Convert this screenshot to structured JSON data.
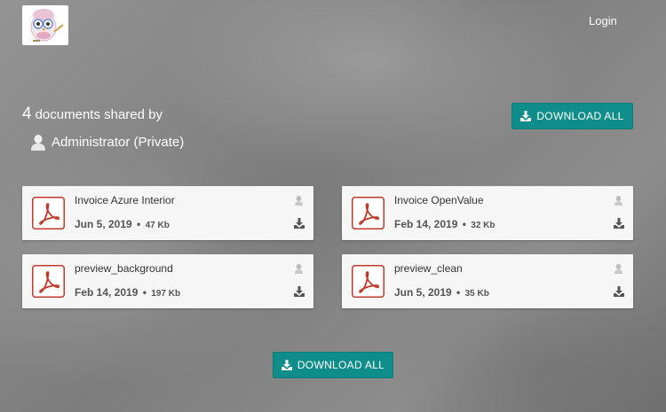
{
  "header": {
    "login_label": "Login"
  },
  "share": {
    "count": "4",
    "heading_text": "documents shared by",
    "owner": "Administrator (Private)"
  },
  "actions": {
    "download_all_label": "DOWNLOAD ALL"
  },
  "documents": [
    {
      "name": "Invoice Azure Interior",
      "date": "Jun 5, 2019",
      "size": "47 Kb"
    },
    {
      "name": "Invoice OpenValue",
      "date": "Feb 14, 2019",
      "size": "32 Kb"
    },
    {
      "name": "preview_background",
      "date": "Feb 14, 2019",
      "size": "197 Kb"
    },
    {
      "name": "preview_clean",
      "date": "Jun 5, 2019",
      "size": "35 Kb"
    }
  ],
  "colors": {
    "accent": "#0f8d8a",
    "pdf_red": "#c0392b"
  },
  "icons": {
    "logo": "owl-logo-icon",
    "owner": "user-silhouette-icon",
    "file": "pdf-file-icon",
    "uploader": "user-silhouette-icon",
    "download": "download-icon"
  }
}
